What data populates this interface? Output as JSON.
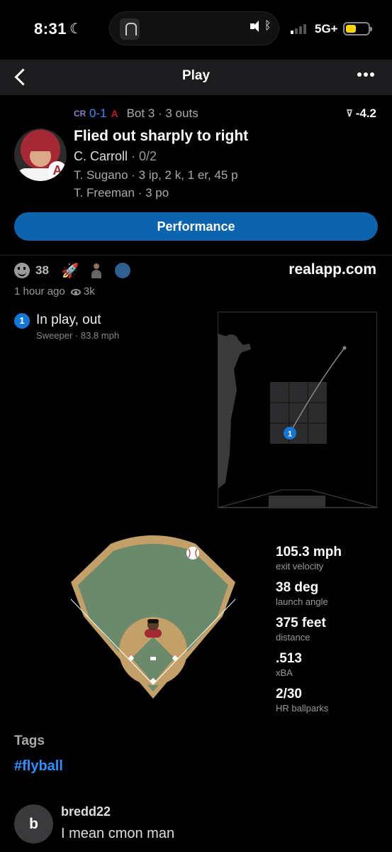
{
  "status_bar": {
    "time": "8:31",
    "network": "5G+",
    "signal_bars": 4,
    "signal_active": 1,
    "battery_level": 0.35
  },
  "nav": {
    "title": "Play"
  },
  "play": {
    "score": "0-1",
    "inning": "Bot 3 · 3 outs",
    "wpa": "-4.2",
    "title": "Flied out sharply to right",
    "batter_name": "C. Carroll",
    "batter_line": " · 0/2",
    "pitcher_line": "T. Sugano · 3 ip, 2 k, 1 er, 45 p",
    "fielder_line": "T. Freeman · 3 po"
  },
  "performance_button": "Performance",
  "reactions": {
    "count": "38",
    "brand": "realapp.com",
    "time_ago": "1 hour ago",
    "views": "3k"
  },
  "pitch": {
    "number": "1",
    "result": "In play, out",
    "detail": "Sweeper ·  83.8 mph"
  },
  "stats": [
    {
      "value": "105.3 mph",
      "label": "exit velocity"
    },
    {
      "value": "38 deg",
      "label": "launch angle"
    },
    {
      "value": "375 feet",
      "label": "distance"
    },
    {
      "value": ".513",
      "label": "xBA"
    },
    {
      "value": "2/30",
      "label": "HR ballparks"
    }
  ],
  "tags": {
    "title": "Tags",
    "items": [
      "#flyball"
    ]
  },
  "comment": {
    "avatar_letter": "b",
    "user": "bredd22",
    "text": "I mean cmon man"
  },
  "colors": {
    "accent_blue": "#0b64ad",
    "link_blue": "#2f8fff",
    "pitch_blue": "#1477d6",
    "field_green": "#6b8a6b",
    "dirt": "#c2a068"
  }
}
